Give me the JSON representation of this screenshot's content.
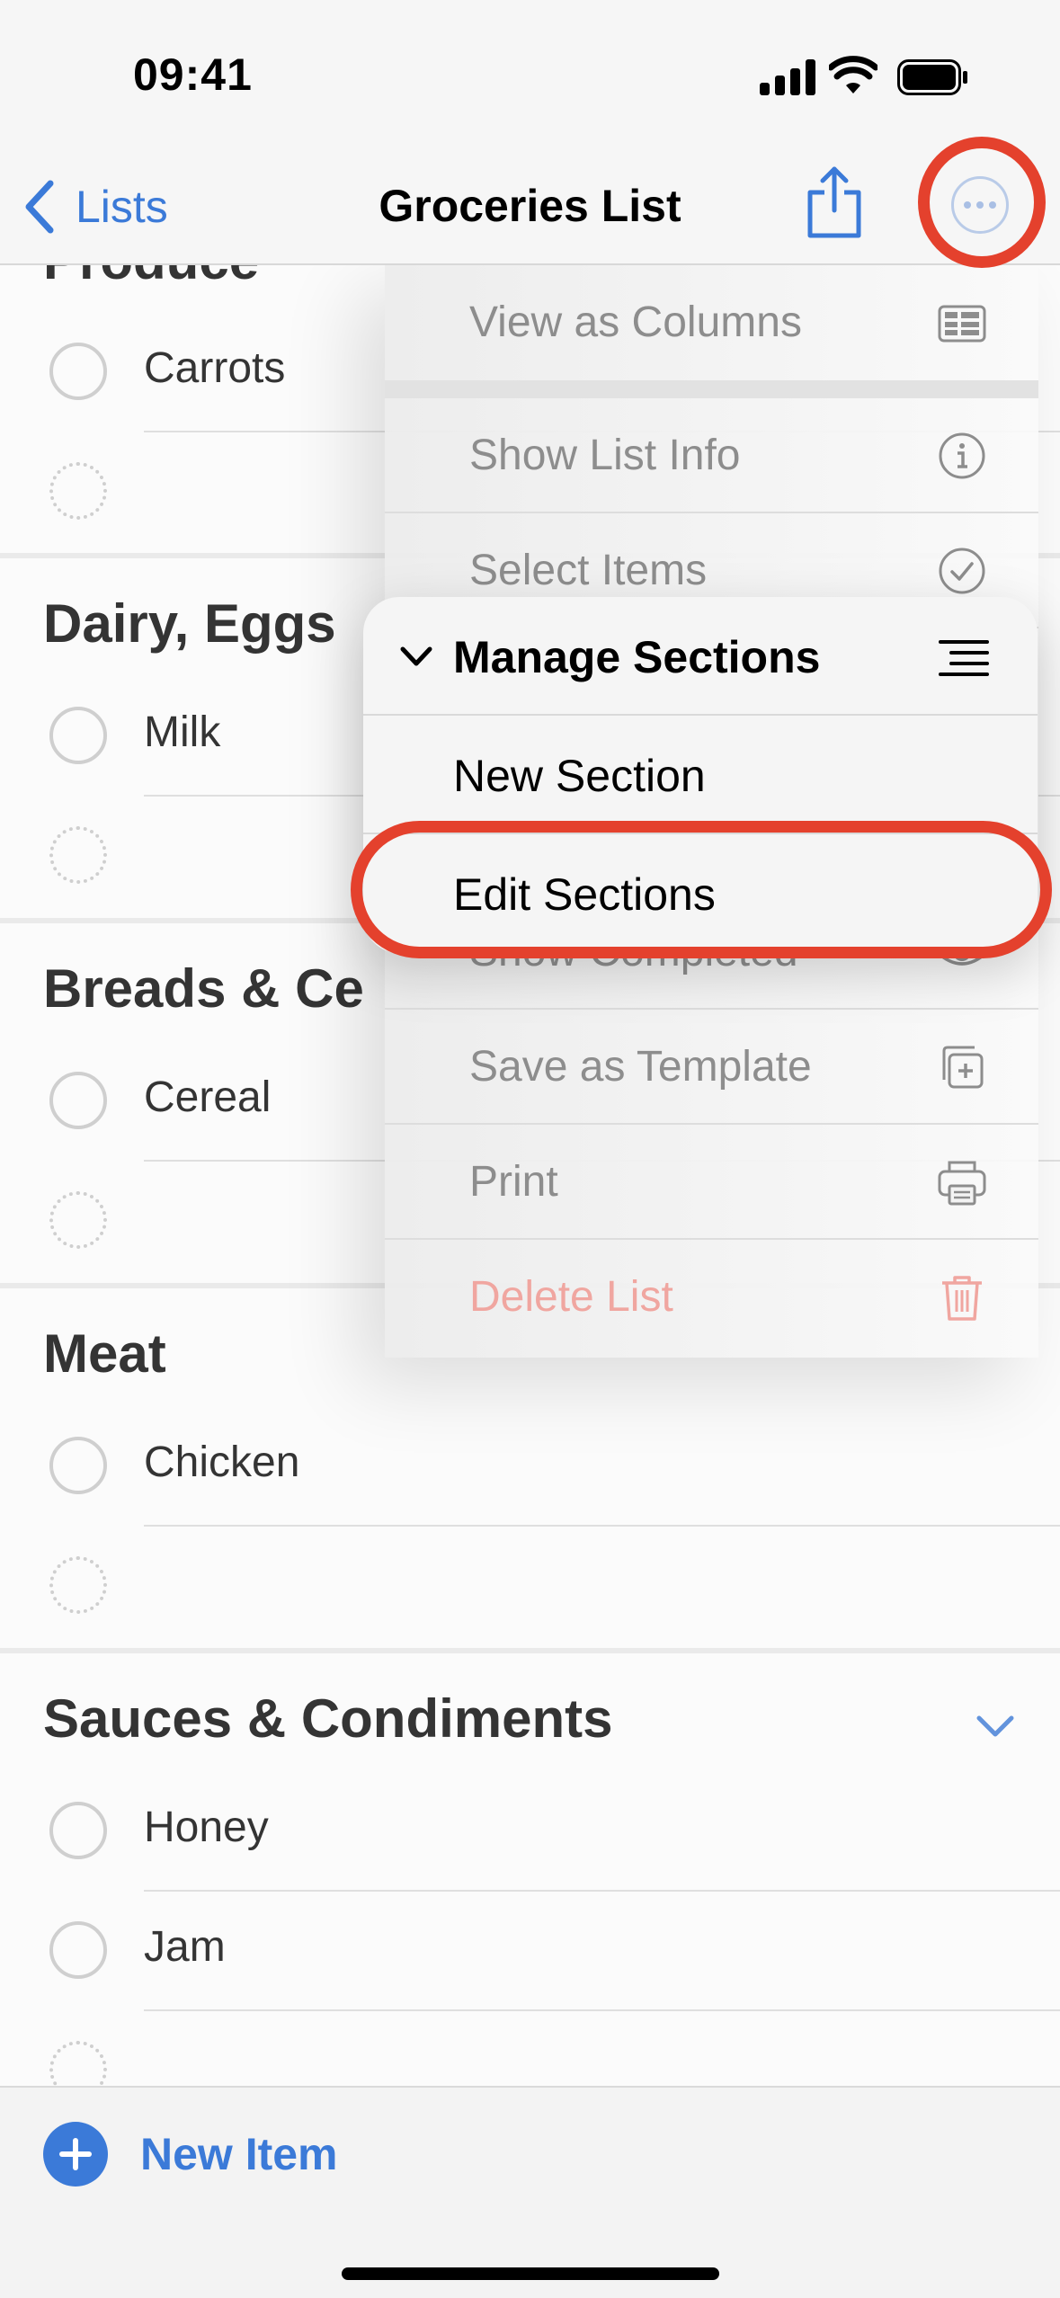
{
  "status_bar": {
    "time": "09:41"
  },
  "nav": {
    "back_label": "Lists",
    "title": "Groceries List"
  },
  "sections": [
    {
      "title": "Produce",
      "items": [
        "Carrots"
      ]
    },
    {
      "title": "Dairy, Eggs",
      "items": [
        "Milk"
      ]
    },
    {
      "title": "Breads & Ce",
      "items": [
        "Cereal"
      ]
    },
    {
      "title": "Meat",
      "items": [
        "Chicken"
      ]
    },
    {
      "title": "Sauces & Condiments",
      "items": [
        "Honey",
        "Jam"
      ]
    }
  ],
  "menu": {
    "items": [
      {
        "label": "View as Columns",
        "icon": "columns-icon"
      },
      {
        "label": "Show List Info",
        "icon": "info-icon"
      },
      {
        "label": "Select Items",
        "icon": "checkmark-circle-icon"
      },
      {
        "label": "Show Completed",
        "icon": "eye-icon"
      },
      {
        "label": "Save as Template",
        "icon": "add-template-icon"
      },
      {
        "label": "Print",
        "icon": "printer-icon"
      },
      {
        "label": "Delete List",
        "icon": "trash-icon"
      }
    ]
  },
  "submenu": {
    "title": "Manage Sections",
    "items": [
      "New Section",
      "Edit Sections"
    ]
  },
  "toolbar": {
    "new_item_label": "New Item"
  },
  "colors": {
    "accent": "#3b7ad8",
    "annotation": "#e4412d",
    "danger": "#f0a6a0"
  }
}
